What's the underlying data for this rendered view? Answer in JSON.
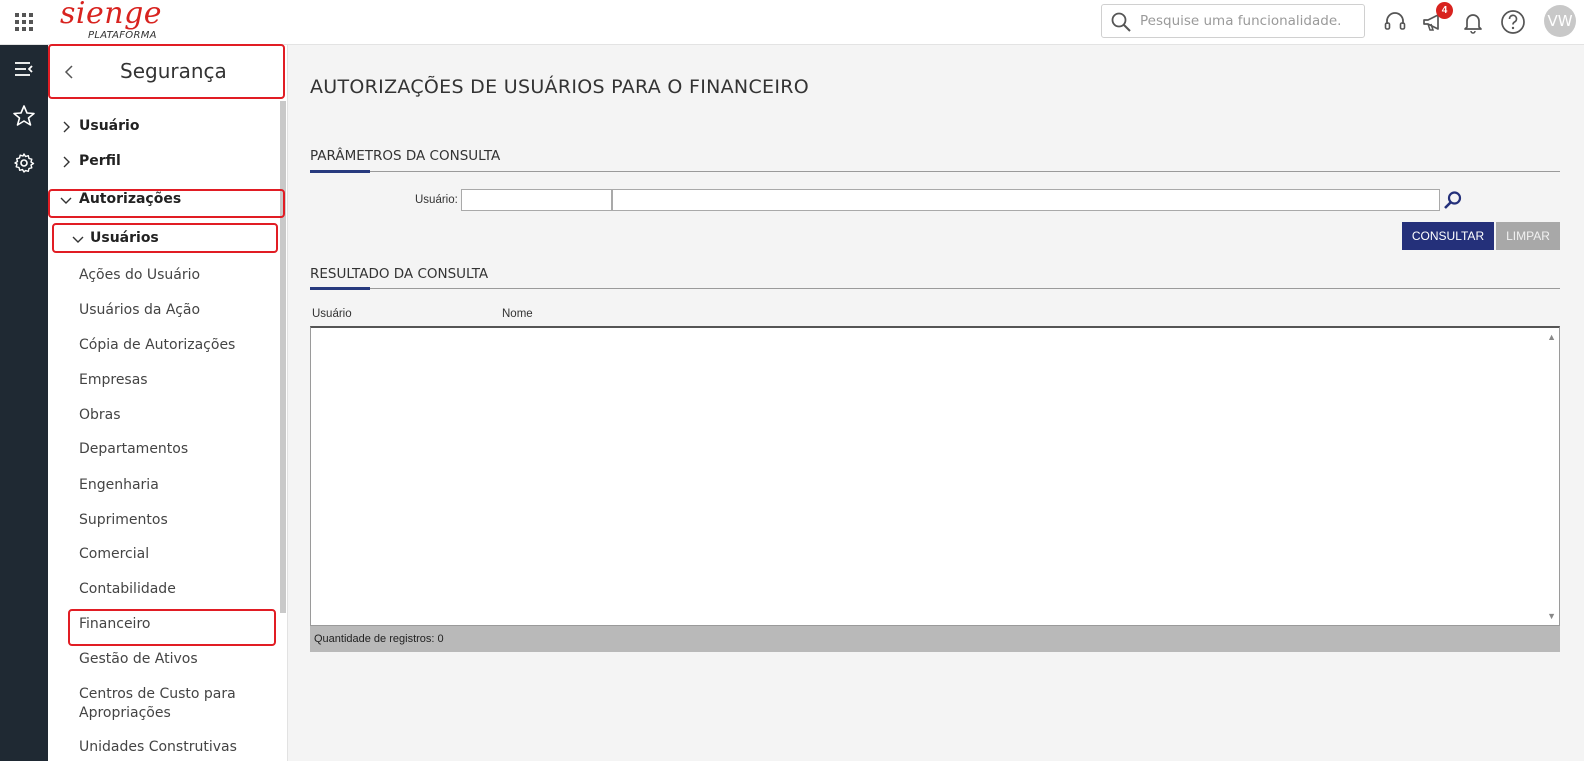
{
  "brand": {
    "logo": "sienge",
    "sub": "PLATAFORMA",
    "color": "#d8231f"
  },
  "header": {
    "search_placeholder": "Pesquise uma funcionalidade.",
    "notification_count": "4",
    "avatar_initials": "VW",
    "icons": [
      "apps-grid-icon",
      "search-icon",
      "headset-icon",
      "megaphone-icon",
      "bell-icon",
      "help-icon"
    ]
  },
  "rail": {
    "icons": [
      "menu-collapse-icon",
      "star-icon",
      "gear-icon"
    ]
  },
  "sidebar": {
    "title": "Segurança",
    "items": [
      {
        "label": "Usuário"
      },
      {
        "label": "Perfil"
      },
      {
        "label": "Autorizações"
      },
      {
        "label": "Usuários"
      },
      {
        "label": "Ações do Usuário"
      },
      {
        "label": "Usuários da Ação"
      },
      {
        "label": "Cópia de Autorizações"
      },
      {
        "label": "Empresas"
      },
      {
        "label": "Obras"
      },
      {
        "label": "Departamentos"
      },
      {
        "label": "Engenharia"
      },
      {
        "label": "Suprimentos"
      },
      {
        "label": "Comercial"
      },
      {
        "label": "Contabilidade"
      },
      {
        "label": "Financeiro"
      },
      {
        "label": "Gestão de Ativos"
      },
      {
        "label": "Centros de Custo para"
      },
      {
        "label": "Apropriações"
      },
      {
        "label": "Unidades Construtivas"
      }
    ]
  },
  "main": {
    "page_title": "AUTORIZAÇÕES DE USUÁRIOS PARA O FINANCEIRO",
    "params_title": "PARÂMETROS DA CONSULTA",
    "user_label": "Usuário:",
    "consultar_label": "CONSULTAR",
    "limpar_label": "LIMPAR",
    "results_title": "RESULTADO DA CONSULTA",
    "columns": [
      "Usuário",
      "Nome"
    ],
    "record_count_text": "Quantidade de registros: 0"
  }
}
